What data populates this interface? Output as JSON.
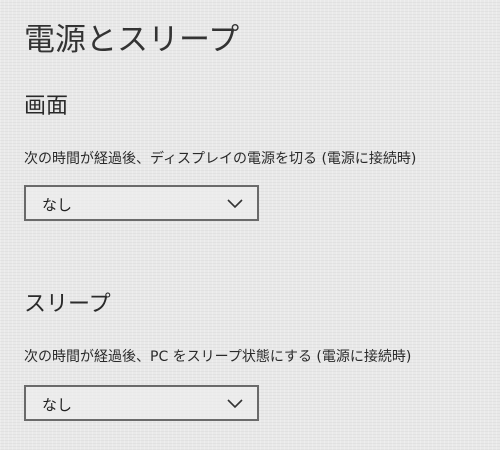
{
  "page": {
    "title": "電源とスリープ"
  },
  "screen_section": {
    "heading": "画面",
    "label": "次の時間が経過後、ディスプレイの電源を切る (電源に接続時)",
    "selected_value": "なし"
  },
  "sleep_section": {
    "heading": "スリープ",
    "label": "次の時間が経過後、PC をスリープ状態にする (電源に接続時)",
    "selected_value": "なし"
  },
  "icons": {
    "dropdown_arrow": "chevron-down-icon"
  }
}
